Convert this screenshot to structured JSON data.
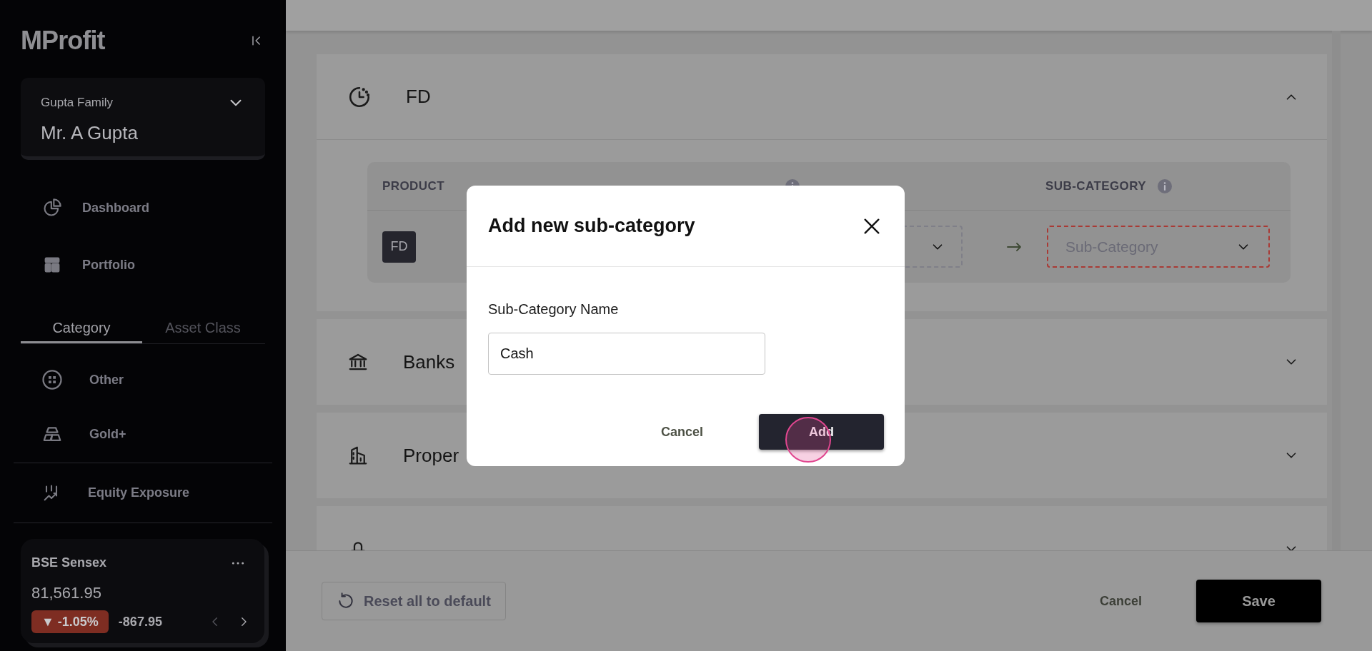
{
  "sidebar": {
    "logo": "MProfit",
    "family": {
      "group": "Gupta Family",
      "member": "Mr. A Gupta"
    },
    "nav": [
      {
        "label": "Dashboard",
        "kind": "pie"
      },
      {
        "label": "Portfolio",
        "kind": "grid"
      }
    ],
    "tabs": [
      {
        "label": "Category",
        "selected": true
      },
      {
        "label": "Asset Class",
        "selected": false
      }
    ],
    "categories": [
      {
        "label": "Other",
        "kind": "other"
      },
      {
        "label": "Gold+",
        "kind": "gold"
      }
    ],
    "exposure": {
      "label": "Equity Exposure"
    },
    "ticker": {
      "name": "BSE Sensex",
      "value": "81,561.95",
      "change_pct": "▼ -1.05%",
      "change": "-867.95"
    }
  },
  "sections": [
    {
      "title": "FD",
      "kind": "clock",
      "expanded": true,
      "table": {
        "columns": [
          {
            "label": "PRODUCT",
            "info": false
          },
          {
            "info": true
          },
          {
            "label": "SUB-CATEGORY",
            "info": true
          }
        ],
        "rows": [
          {
            "product": "FD",
            "category": {
              "error": false
            },
            "sub_category": {
              "placeholder": "Sub-Category",
              "error": true
            }
          }
        ]
      }
    },
    {
      "title": "Banks",
      "kind": "bank",
      "expanded": false
    },
    {
      "title": "Proper",
      "kind": "building",
      "expanded": false
    },
    {
      "kind": "goldbag",
      "expanded": false
    }
  ],
  "footer": {
    "reset": "Reset all to default",
    "cancel": "Cancel",
    "save": "Save"
  },
  "dialog": {
    "title": "Add new sub-category",
    "field_label": "Sub-Category Name",
    "value": "Cash",
    "cancel": "Cancel",
    "add": "Add"
  }
}
